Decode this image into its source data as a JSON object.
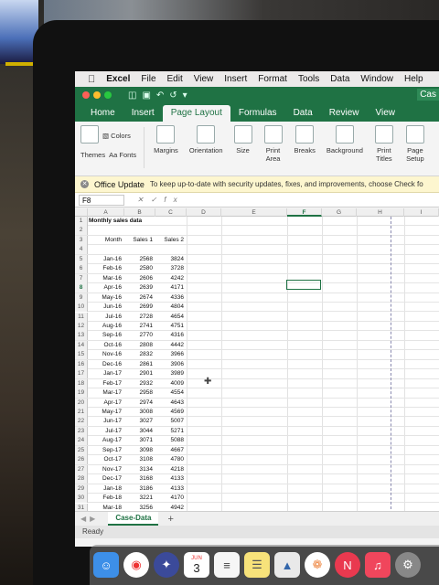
{
  "menubar": {
    "app": "Excel",
    "items": [
      "File",
      "Edit",
      "View",
      "Insert",
      "Format",
      "Tools",
      "Data",
      "Window",
      "Help"
    ]
  },
  "titlebar": {
    "doc": "Cas"
  },
  "ribbon_tabs": [
    "Home",
    "Insert",
    "Page Layout",
    "Formulas",
    "Data",
    "Review",
    "View"
  ],
  "active_tab": "Page Layout",
  "ribbon": {
    "themes": "Themes",
    "colors": "Colors",
    "fonts": "Fonts",
    "margins": "Margins",
    "orientation": "Orientation",
    "size": "Size",
    "print_area": "Print Area",
    "breaks": "Breaks",
    "background": "Background",
    "print_titles": "Print Titles",
    "page_setup": "Page Setup"
  },
  "update_bar": {
    "title": "Office Update",
    "message": "To keep up-to-date with security updates, fixes, and improvements, choose Check fo"
  },
  "formula_bar": {
    "name_box": "F8",
    "fx": "fx"
  },
  "columns": [
    "A",
    "B",
    "C",
    "D",
    "E",
    "F",
    "G",
    "H",
    "I"
  ],
  "active_column": "F",
  "sheet": {
    "title": "Monthly sales data",
    "headers": [
      "Month",
      "Sales 1",
      "Sales 2"
    ],
    "rows": [
      [
        "Jan-16",
        "2568",
        "3824"
      ],
      [
        "Feb-16",
        "2580",
        "3728"
      ],
      [
        "Mar-16",
        "2606",
        "4242"
      ],
      [
        "Apr-16",
        "2639",
        "4171"
      ],
      [
        "May-16",
        "2674",
        "4336"
      ],
      [
        "Jun-16",
        "2699",
        "4804"
      ],
      [
        "Jul-16",
        "2728",
        "4654"
      ],
      [
        "Aug-16",
        "2741",
        "4751"
      ],
      [
        "Sep-16",
        "2770",
        "4316"
      ],
      [
        "Oct-16",
        "2808",
        "4442"
      ],
      [
        "Nov-16",
        "2832",
        "3966"
      ],
      [
        "Dec-16",
        "2861",
        "3906"
      ],
      [
        "Jan-17",
        "2901",
        "3989"
      ],
      [
        "Feb-17",
        "2932",
        "4009"
      ],
      [
        "Mar-17",
        "2958",
        "4554"
      ],
      [
        "Apr-17",
        "2974",
        "4643"
      ],
      [
        "May-17",
        "3008",
        "4569"
      ],
      [
        "Jun-17",
        "3027",
        "5007"
      ],
      [
        "Jul-17",
        "3044",
        "5271"
      ],
      [
        "Aug-17",
        "3071",
        "5088"
      ],
      [
        "Sep-17",
        "3098",
        "4667"
      ],
      [
        "Oct-17",
        "3108",
        "4780"
      ],
      [
        "Nov-17",
        "3134",
        "4218"
      ],
      [
        "Dec-17",
        "3168",
        "4133"
      ],
      [
        "Jan-18",
        "3186",
        "4133"
      ],
      [
        "Feb-18",
        "3221",
        "4170"
      ],
      [
        "Mar-18",
        "3256",
        "4942"
      ]
    ]
  },
  "sheet_tab": "Case-Data",
  "status": "Ready",
  "dock": {
    "calendar_month": "JUN",
    "calendar_day": "3"
  }
}
